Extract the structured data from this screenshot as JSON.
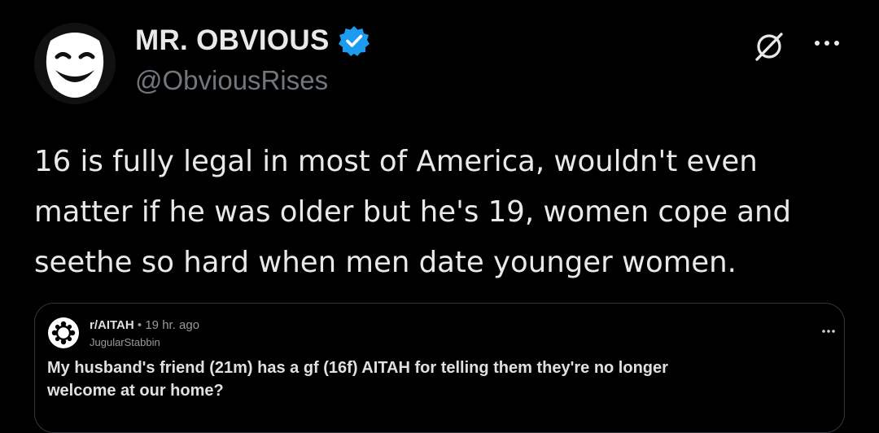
{
  "tweet": {
    "display_name": "MR. OBVIOUS",
    "handle": "@ObviousRises",
    "verified_icon": "verified-badge-icon",
    "verified_color": "#1d9bf0",
    "text_lines": [
      "16 is fully legal in most of America, wouldn't even",
      "matter if he was older but he's 19, women cope and",
      "seethe so hard when men date younger women."
    ]
  },
  "quoted_post": {
    "subreddit": "r/AITAH",
    "separator": "•",
    "time": "19 hr. ago",
    "author": "JugularStabbin",
    "title_lines": [
      "My husband's friend (21m) has a gf (16f) AITAH for telling them they're no longer",
      "welcome at our home?"
    ]
  }
}
